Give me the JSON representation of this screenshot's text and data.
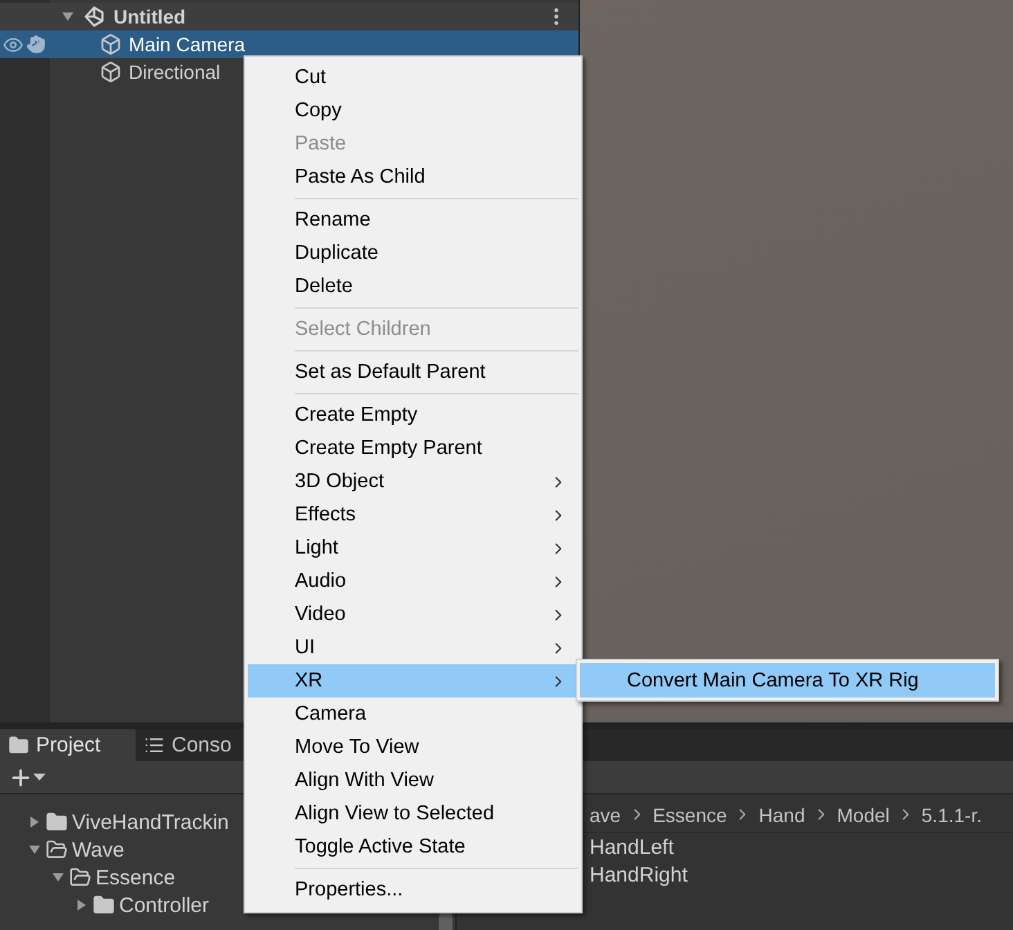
{
  "hierarchy": {
    "scene": {
      "name": "Untitled",
      "expanded": true
    },
    "objects": [
      {
        "name": "Main Camera",
        "selected": true
      },
      {
        "name": "Directional",
        "selected": false
      }
    ]
  },
  "menu": {
    "items": [
      {
        "kind": "item",
        "label": "Cut",
        "disabled": false,
        "submenu": false,
        "selected": false
      },
      {
        "kind": "item",
        "label": "Copy",
        "disabled": false,
        "submenu": false,
        "selected": false
      },
      {
        "kind": "item",
        "label": "Paste",
        "disabled": true,
        "submenu": false,
        "selected": false
      },
      {
        "kind": "item",
        "label": "Paste As Child",
        "disabled": false,
        "submenu": false,
        "selected": false
      },
      {
        "kind": "separator"
      },
      {
        "kind": "item",
        "label": "Rename",
        "disabled": false,
        "submenu": false,
        "selected": false
      },
      {
        "kind": "item",
        "label": "Duplicate",
        "disabled": false,
        "submenu": false,
        "selected": false
      },
      {
        "kind": "item",
        "label": "Delete",
        "disabled": false,
        "submenu": false,
        "selected": false
      },
      {
        "kind": "separator"
      },
      {
        "kind": "item",
        "label": "Select Children",
        "disabled": true,
        "submenu": false,
        "selected": false
      },
      {
        "kind": "separator"
      },
      {
        "kind": "item",
        "label": "Set as Default Parent",
        "disabled": false,
        "submenu": false,
        "selected": false
      },
      {
        "kind": "separator"
      },
      {
        "kind": "item",
        "label": "Create Empty",
        "disabled": false,
        "submenu": false,
        "selected": false
      },
      {
        "kind": "item",
        "label": "Create Empty Parent",
        "disabled": false,
        "submenu": false,
        "selected": false
      },
      {
        "kind": "item",
        "label": "3D Object",
        "disabled": false,
        "submenu": true,
        "selected": false
      },
      {
        "kind": "item",
        "label": "Effects",
        "disabled": false,
        "submenu": true,
        "selected": false
      },
      {
        "kind": "item",
        "label": "Light",
        "disabled": false,
        "submenu": true,
        "selected": false
      },
      {
        "kind": "item",
        "label": "Audio",
        "disabled": false,
        "submenu": true,
        "selected": false
      },
      {
        "kind": "item",
        "label": "Video",
        "disabled": false,
        "submenu": true,
        "selected": false
      },
      {
        "kind": "item",
        "label": "UI",
        "disabled": false,
        "submenu": true,
        "selected": false
      },
      {
        "kind": "item",
        "label": "XR",
        "disabled": false,
        "submenu": true,
        "selected": true
      },
      {
        "kind": "item",
        "label": "Camera",
        "disabled": false,
        "submenu": false,
        "selected": false
      },
      {
        "kind": "item",
        "label": "Move To View",
        "disabled": false,
        "submenu": false,
        "selected": false
      },
      {
        "kind": "item",
        "label": "Align With View",
        "disabled": false,
        "submenu": false,
        "selected": false
      },
      {
        "kind": "item",
        "label": "Align View to Selected",
        "disabled": false,
        "submenu": false,
        "selected": false
      },
      {
        "kind": "item",
        "label": "Toggle Active State",
        "disabled": false,
        "submenu": false,
        "selected": false
      },
      {
        "kind": "separator"
      },
      {
        "kind": "item",
        "label": "Properties...",
        "disabled": false,
        "submenu": false,
        "selected": false
      }
    ]
  },
  "submenu": {
    "items": [
      {
        "label": "Convert Main Camera To XR Rig",
        "selected": true
      }
    ]
  },
  "bottom_panel": {
    "tabs": [
      {
        "label": "Project",
        "kind": "folder",
        "selected": true
      },
      {
        "label": "Conso",
        "kind": "list",
        "selected": false
      }
    ],
    "tree": [
      {
        "name": "ViveHandTrackin",
        "expanded": false
      },
      {
        "name": "Wave",
        "expanded": true,
        "children": [
          {
            "name": "Essence",
            "expanded": true,
            "children": [
              {
                "name": "Controller",
                "expanded": false
              }
            ]
          }
        ]
      }
    ],
    "breadcrumb": [
      "ave",
      "Essence",
      "Hand",
      "Model",
      "5.1.1-r."
    ],
    "files": [
      "HandLeft",
      "HandRight"
    ]
  }
}
